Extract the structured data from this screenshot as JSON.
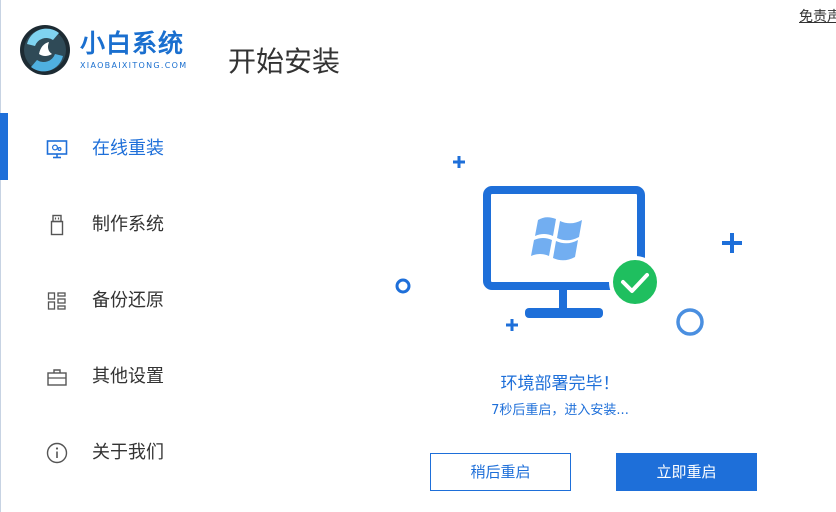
{
  "header": {
    "brand_name": "小白系统",
    "brand_sub": "XIAOBAIXITONG.COM",
    "page_title": "开始安装",
    "disclaimer": "免责声"
  },
  "sidebar": {
    "items": [
      {
        "label": "在线重装",
        "icon": "monitor-icon",
        "active": true
      },
      {
        "label": "制作系统",
        "icon": "usb-drive-icon",
        "active": false
      },
      {
        "label": "备份还原",
        "icon": "backup-grid-icon",
        "active": false
      },
      {
        "label": "其他设置",
        "icon": "briefcase-icon",
        "active": false
      },
      {
        "label": "关于我们",
        "icon": "info-icon",
        "active": false
      }
    ]
  },
  "main": {
    "illustration": {
      "icon": "windows-monitor-icon",
      "badge": "checkmark-icon"
    },
    "status_title": "环境部署完毕！",
    "status_sub": "7秒后重启，进入安装...",
    "buttons": {
      "later": "稍后重启",
      "now": "立即重启"
    }
  },
  "colors": {
    "accent": "#1e6fd9",
    "success": "#1fbf5f",
    "text": "#333333"
  }
}
